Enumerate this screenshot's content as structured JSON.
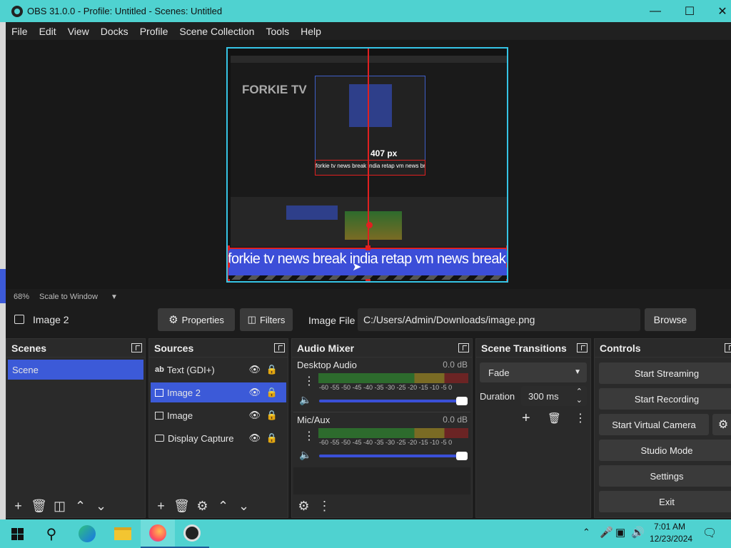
{
  "window": {
    "title": "OBS 31.0.0 - Profile: Untitled - Scenes: Untitled"
  },
  "menu": [
    "File",
    "Edit",
    "View",
    "Docks",
    "Profile",
    "Scene Collection",
    "Tools",
    "Help"
  ],
  "preview": {
    "zoom": "68%",
    "scale_mode": "Scale to Window",
    "ticker_text": "forkie tv news break india retap vm news break kaza",
    "inner_ticker_text": "forkie tv news break india retap vm news break kaza",
    "logo_text": "FORKIE TV",
    "size_label": "407 px"
  },
  "propbar": {
    "selected_source": "Image 2",
    "properties_label": "Properties",
    "filters_label": "Filters",
    "image_file_label": "Image File",
    "image_path": "C:/Users/Admin/Downloads/image.png",
    "browse_label": "Browse"
  },
  "scenes": {
    "title": "Scenes",
    "items": [
      "Scene"
    ]
  },
  "sources": {
    "title": "Sources",
    "items": [
      {
        "label": "Text (GDI+)",
        "icon": "text-icon"
      },
      {
        "label": "Image 2",
        "icon": "image-icon"
      },
      {
        "label": "Image",
        "icon": "image-icon"
      },
      {
        "label": "Display Capture",
        "icon": "monitor-icon"
      }
    ]
  },
  "mixer": {
    "title": "Audio Mixer",
    "channels": [
      {
        "name": "Desktop Audio",
        "db": "0.0 dB"
      },
      {
        "name": "Mic/Aux",
        "db": "0.0 dB"
      }
    ],
    "scale": "-60 -55 -50 -45 -40 -35 -30 -25 -20 -15 -10 -5 0"
  },
  "transitions": {
    "title": "Scene Transitions",
    "selected": "Fade",
    "duration_label": "Duration",
    "duration_value": "300 ms"
  },
  "controls": {
    "title": "Controls",
    "start_streaming": "Start Streaming",
    "start_recording": "Start Recording",
    "start_virtual_camera": "Start Virtual Camera",
    "studio_mode": "Studio Mode",
    "settings": "Settings",
    "exit": "Exit"
  },
  "taskbar": {
    "time": "7:01 AM",
    "date": "12/23/2024"
  },
  "colors": {
    "accent": "#3c5ad8",
    "titlebar": "#4fd2d0",
    "selection": "#e02020",
    "canvas_border": "#35c4e5"
  }
}
